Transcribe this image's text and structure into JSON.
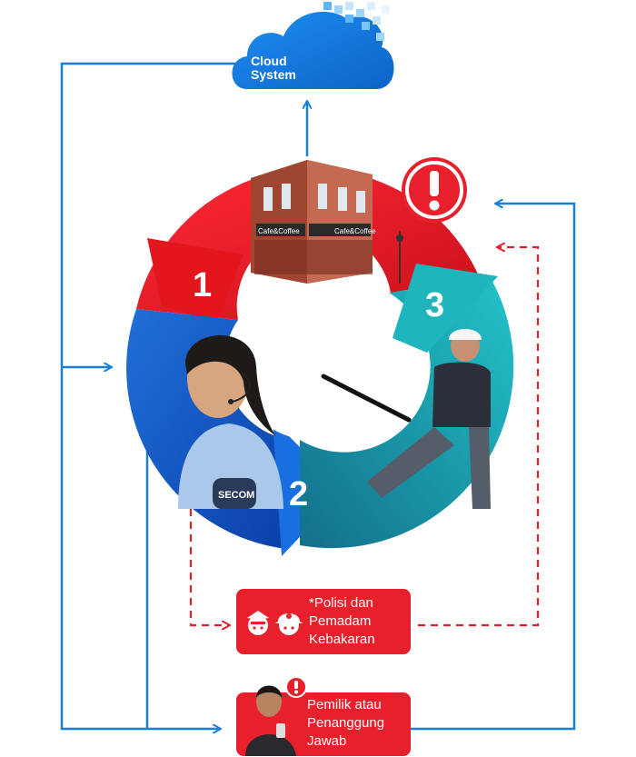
{
  "cloud": {
    "line1": "Cloud",
    "line2": "System"
  },
  "cycle": {
    "step1": "1",
    "step2": "2",
    "step3": "3"
  },
  "building": {
    "sign_left": "Cafe&Coffee",
    "sign_right": "Cafe&Coffee"
  },
  "operator": {
    "badge": "SECOM"
  },
  "emergency_services": {
    "line1": "*Polisi dan",
    "line2": "Pemadam",
    "line3": "Kebakaran"
  },
  "owner": {
    "line1": "Pemilik atau",
    "line2": "Penanggung",
    "line3": "Jawab"
  },
  "colors": {
    "blue_arrow": "#1a7fd8",
    "red_dashed": "#e8202b",
    "red_segment": "#e3151d",
    "blue_segment": "#1466d6",
    "teal_segment": "#1fb5bd",
    "cloud_blue": "#1a78de"
  },
  "icons": [
    "cloud-icon",
    "alert-icon",
    "police-icon",
    "firefighter-icon",
    "owner-photo",
    "alert-badge-icon"
  ]
}
